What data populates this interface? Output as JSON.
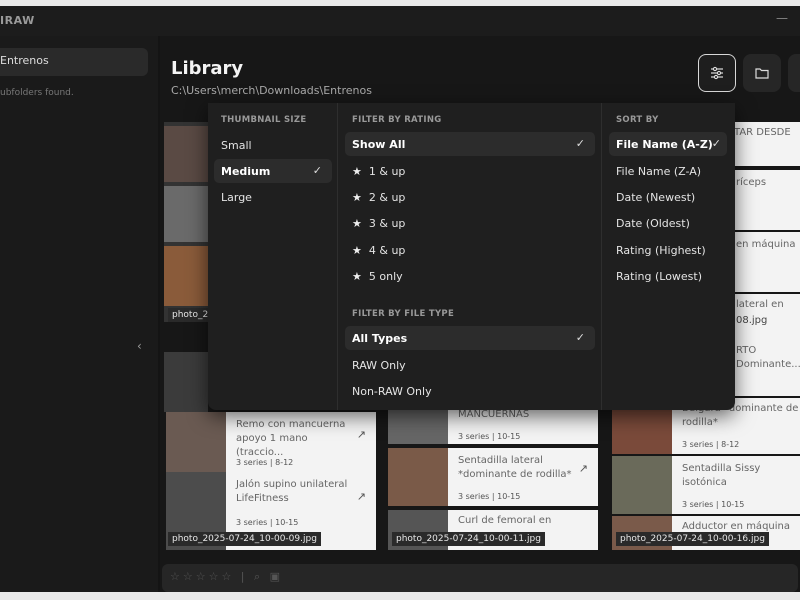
{
  "app": {
    "title": "IRAW"
  },
  "sidebar": {
    "folder_label": "Entrenos",
    "subfolders_text": "ubfolders found."
  },
  "library": {
    "title": "Library",
    "path": "C:\\Users\\merch\\Downloads\\Entrenos"
  },
  "popup": {
    "thumbnail_size": {
      "heading": "THUMBNAIL SIZE",
      "options": [
        "Small",
        "Medium",
        "Large"
      ],
      "selected": "Medium"
    },
    "filter_rating": {
      "heading": "FILTER BY RATING",
      "options": [
        "Show All",
        "1 & up",
        "2 & up",
        "3 & up",
        "4 & up",
        "5 only"
      ],
      "selected": "Show All"
    },
    "filter_type": {
      "heading": "FILTER BY FILE TYPE",
      "options": [
        "All Types",
        "RAW Only",
        "Non-RAW Only"
      ],
      "selected": "All Types"
    },
    "sort_by": {
      "heading": "SORT BY",
      "options": [
        "File Name (A-Z)",
        "File Name (Z-A)",
        "Date (Newest)",
        "Date (Oldest)",
        "Rating (Highest)",
        "Rating (Lowest)"
      ],
      "selected": "File Name (A-Z)"
    }
  },
  "cards": {
    "c1": {
      "title": "Remo con mancuerna apoyo 1 mano (traccio...",
      "meta": "3 series | 8-12"
    },
    "c2": {
      "title": "Jalón supino unilateral LifeFitness",
      "meta": "3 series | 10-15"
    },
    "c3": {
      "title": "MANCUERNAS",
      "meta": "3 series | 10-15"
    },
    "c4": {
      "title": "Sentadilla lateral *dominante de rodilla*",
      "meta": "3 series | 10-15"
    },
    "c5": {
      "title": "Curl de femoral en",
      "meta": ""
    },
    "c6": {
      "title": "Búlgara *dominante de rodilla*",
      "meta": "3 series | 8-12"
    },
    "c7": {
      "title": "Sentadilla Sissy isotónica",
      "meta": "3 series | 10-15"
    },
    "c8": {
      "title": "Adductor en máquina",
      "meta": ""
    },
    "r1": {
      "title": "TAR DESDE"
    },
    "r2": {
      "title": "ríceps"
    },
    "r3": {
      "title": "en máquina"
    },
    "r4": {
      "title": "lateral en"
    },
    "r5": {
      "title": "RTO Dominante..."
    }
  },
  "photo_labels": {
    "p1": "photo_2",
    "p2": "photo_2025-07-24_10-00-09.jpg",
    "p3": "photo_2025-07-24_10-00-11.jpg",
    "p4": "photo_2025-07-24_10-00-16.jpg",
    "p5": "08.jpg"
  },
  "icons": {
    "check": "✓",
    "star": "★",
    "arrow": "↗",
    "chevron": "‹",
    "sliders": "⚌",
    "folder": "▭"
  }
}
